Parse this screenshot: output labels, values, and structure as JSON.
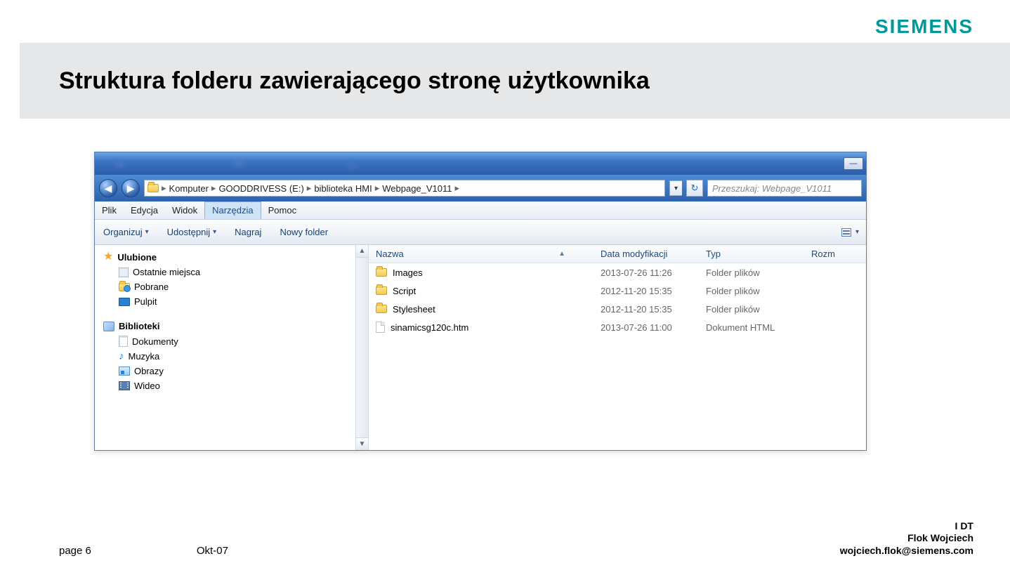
{
  "brand": "SIEMENS",
  "slide": {
    "title": "Struktura folderu zawierającego stronę użytkownika",
    "page_label": "page 6",
    "date": "Okt-07",
    "dept": "I DT",
    "author": "Flok Wojciech",
    "email": "wojciech.flok@siemens.com"
  },
  "explorer": {
    "breadcrumb": [
      "Komputer",
      "GOODDRIVESS (E:)",
      "biblioteka HMI",
      "Webpage_V1011"
    ],
    "search_placeholder": "Przeszukaj: Webpage_V1011",
    "menu": {
      "plik": "Plik",
      "edycja": "Edycja",
      "widok": "Widok",
      "narzedzia": "Narzędzia",
      "pomoc": "Pomoc"
    },
    "toolbar": {
      "organizuj": "Organizuj",
      "udostepnij": "Udostępnij",
      "nagraj": "Nagraj",
      "nowy": "Nowy folder"
    },
    "columns": {
      "name": "Nazwa",
      "date": "Data modyfikacji",
      "type": "Typ",
      "size": "Rozm"
    },
    "nav": {
      "favorites": "Ulubione",
      "recent": "Ostatnie miejsca",
      "downloads": "Pobrane",
      "desktop": "Pulpit",
      "libraries": "Biblioteki",
      "documents": "Dokumenty",
      "music": "Muzyka",
      "pictures": "Obrazy",
      "videos": "Wideo"
    },
    "files": [
      {
        "name": "Images",
        "date": "2013-07-26 11:26",
        "type": "Folder plików",
        "icon": "folder"
      },
      {
        "name": "Script",
        "date": "2012-11-20 15:35",
        "type": "Folder plików",
        "icon": "folder"
      },
      {
        "name": "Stylesheet",
        "date": "2012-11-20 15:35",
        "type": "Folder plików",
        "icon": "folder"
      },
      {
        "name": "sinamicsg120c.htm",
        "date": "2013-07-26 11:00",
        "type": "Dokument HTML",
        "icon": "file"
      }
    ]
  }
}
